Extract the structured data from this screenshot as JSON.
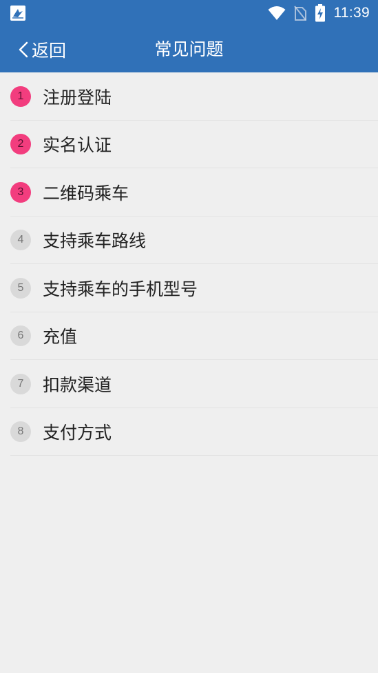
{
  "status_bar": {
    "time": "11:39",
    "icons": [
      "app-logo-icon",
      "wifi-icon",
      "no-sim-icon",
      "battery-charging-icon"
    ]
  },
  "header": {
    "back_label": "返回",
    "title": "常见问题"
  },
  "faq": [
    {
      "number": "1",
      "label": "注册登陆",
      "hot": true
    },
    {
      "number": "2",
      "label": "实名认证",
      "hot": true
    },
    {
      "number": "3",
      "label": "二维码乘车",
      "hot": true
    },
    {
      "number": "4",
      "label": "支持乘车路线",
      "hot": false
    },
    {
      "number": "5",
      "label": "支持乘车的手机型号",
      "hot": false
    },
    {
      "number": "6",
      "label": "充值",
      "hot": false
    },
    {
      "number": "7",
      "label": "扣款渠道",
      "hot": false
    },
    {
      "number": "8",
      "label": "支付方式",
      "hot": false
    }
  ],
  "colors": {
    "header_bg": "#3071b8",
    "hot_badge": "#f23d7e",
    "normal_badge": "#d9d9d9",
    "page_bg": "#efefef"
  }
}
